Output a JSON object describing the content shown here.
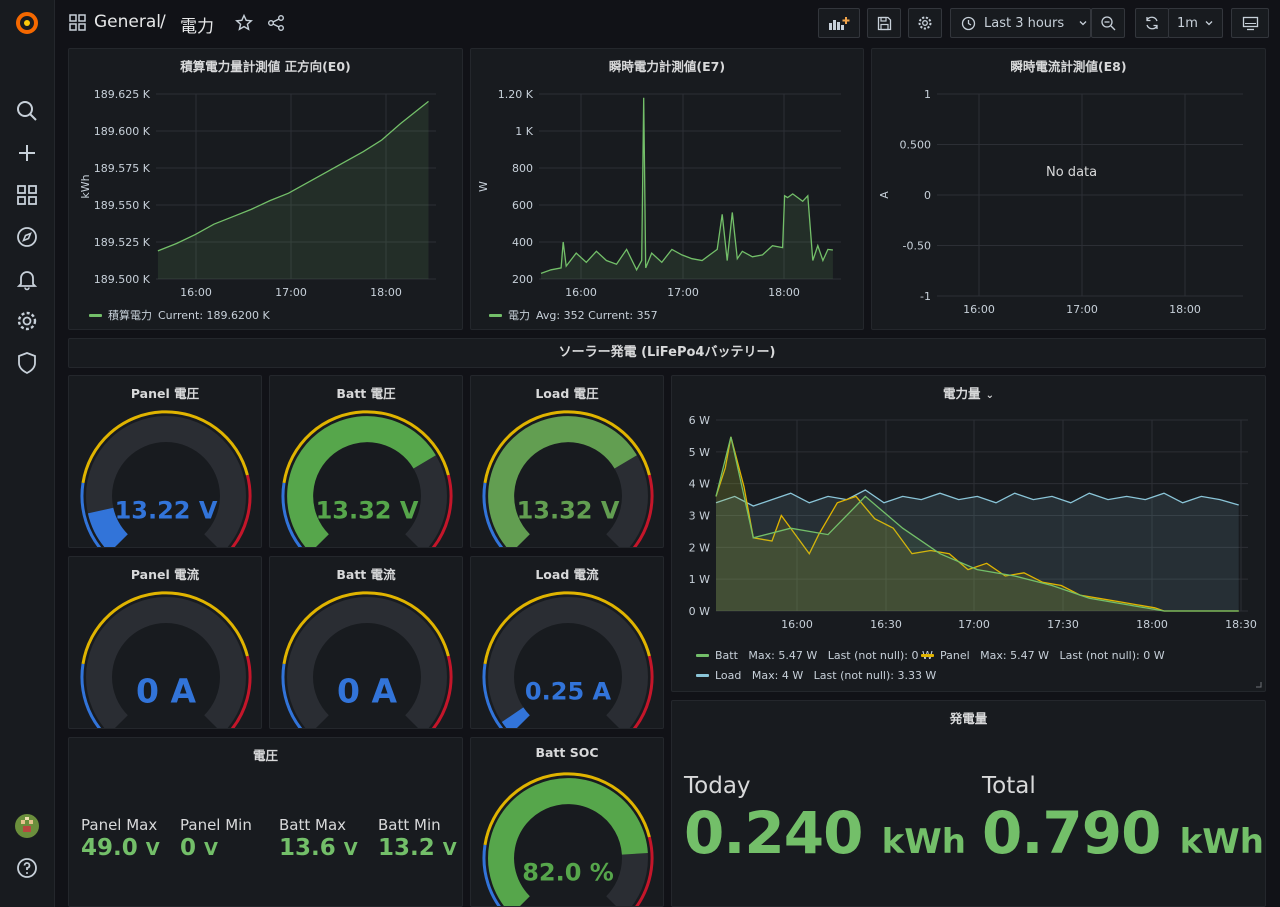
{
  "app": {
    "breadcrumb_folder": "General",
    "breadcrumb_sep": "/",
    "breadcrumb_title": "電力",
    "time_range": "Last 3 hours",
    "refresh_interval": "1m"
  },
  "colors": {
    "bg": "#111217",
    "panel": "#181b1f",
    "green": "#73bf69",
    "yellow": "#e0b400",
    "orange": "#f2cc0c",
    "red": "#c4162a",
    "blue": "#3274d9",
    "cyan": "#8ac5d8",
    "text": "#d8d9da"
  },
  "sidebar": {
    "items": [
      {
        "name": "search-icon"
      },
      {
        "name": "plus-icon"
      },
      {
        "name": "dashboards-icon"
      },
      {
        "name": "explore-icon"
      },
      {
        "name": "alerting-bell-icon"
      },
      {
        "name": "configuration-gear-icon"
      },
      {
        "name": "server-admin-shield-icon"
      }
    ]
  },
  "panels": {
    "energy": {
      "title": "積算電力量計測値 正方向(E0)",
      "legend_name": "積算電力",
      "legend_stats": "Current: 189.6200 K"
    },
    "power": {
      "title": "瞬時電力計測値(E7)",
      "legend_name": "電力",
      "legend_stats": "Avg: 352  Current: 357"
    },
    "current": {
      "title": "瞬時電流計測値(E8)",
      "no_data": "No data"
    },
    "row_title": "ソーラー発電 (LiFePo4バッテリー)",
    "gauges": [
      {
        "title": "Panel 電圧",
        "value": "13.22 V",
        "fraction": 0.12,
        "color": "#3274d9"
      },
      {
        "title": "Batt 電圧",
        "value": "13.32 V",
        "fraction": 0.72,
        "color": "#56a64b"
      },
      {
        "title": "Load 電圧",
        "value": "13.32 V",
        "fraction": 0.72,
        "color": "#629e51"
      },
      {
        "title": "Panel 電流",
        "value": "0 A",
        "fraction": 0.0,
        "color": "#3274d9"
      },
      {
        "title": "Batt 電流",
        "value": "0 A",
        "fraction": 0.0,
        "color": "#3274d9"
      },
      {
        "title": "Load 電流",
        "value": "0.25 A",
        "fraction": 0.04,
        "color": "#3274d9"
      }
    ],
    "power_amount": {
      "title": "電力量",
      "legend_batt": "Batt   Max: 5.47 W   Last (not null): 0 W",
      "legend_panel": "Panel   Max: 5.47 W   Last (not null): 0 W",
      "legend_load": "Load   Max: 4 W   Last (not null): 3.33 W"
    },
    "voltage": {
      "title": "電圧",
      "items": [
        {
          "label": "Panel Max",
          "value": "49.0",
          "unit": "V"
        },
        {
          "label": "Panel Min",
          "value": "0",
          "unit": "V"
        },
        {
          "label": "Batt Max",
          "value": "13.6",
          "unit": "V"
        },
        {
          "label": "Batt Min",
          "value": "13.2",
          "unit": "V"
        }
      ]
    },
    "soc": {
      "title": "Batt SOC",
      "value": "82.0 %",
      "fraction": 0.82
    },
    "generation": {
      "title": "発電量",
      "today_label": "Today",
      "today_value": "0.240",
      "today_unit": "kWh",
      "total_label": "Total",
      "total_value": "0.790",
      "total_unit": "kWh"
    }
  },
  "chart_data": [
    {
      "type": "area",
      "title": "積算電力量計測値 正方向(E0)",
      "ylabel": "kWh",
      "y_ticks": [
        "189.500 K",
        "189.525 K",
        "189.550 K",
        "189.575 K",
        "189.600 K",
        "189.625 K"
      ],
      "x_ticks": [
        "16:00",
        "17:00",
        "18:00"
      ],
      "ylim": [
        189.5,
        189.625
      ],
      "xlim_hours": [
        15.58,
        18.58
      ],
      "series": [
        {
          "name": "積算電力",
          "x": [
            15.6,
            15.8,
            16.0,
            16.2,
            16.4,
            16.6,
            16.8,
            17.0,
            17.2,
            17.4,
            17.6,
            17.8,
            18.0,
            18.2,
            18.4,
            18.5
          ],
          "y": [
            189.519,
            189.524,
            189.53,
            189.537,
            189.542,
            189.547,
            189.553,
            189.558,
            189.565,
            189.572,
            189.579,
            189.586,
            189.594,
            189.605,
            189.615,
            189.62
          ]
        }
      ]
    },
    {
      "type": "line",
      "title": "瞬時電力計測値(E7)",
      "ylabel": "W",
      "y_ticks": [
        "200",
        "400",
        "600",
        "800",
        "1 K",
        "1.20 K"
      ],
      "x_ticks": [
        "16:00",
        "17:00",
        "18:00"
      ],
      "ylim": [
        200,
        1200
      ],
      "xlim_hours": [
        15.58,
        18.58
      ],
      "series": [
        {
          "name": "電力",
          "x": [
            15.6,
            15.7,
            15.8,
            15.82,
            15.85,
            15.95,
            16.05,
            16.15,
            16.25,
            16.35,
            16.45,
            16.55,
            16.6,
            16.62,
            16.64,
            16.7,
            16.8,
            16.9,
            17.0,
            17.1,
            17.2,
            17.3,
            17.35,
            17.4,
            17.45,
            17.5,
            17.55,
            17.6,
            17.7,
            17.8,
            17.9,
            18.0,
            18.02,
            18.05,
            18.1,
            18.2,
            18.25,
            18.3,
            18.35,
            18.4,
            18.45,
            18.5
          ],
          "y": [
            230,
            250,
            260,
            400,
            270,
            340,
            290,
            350,
            300,
            280,
            360,
            250,
            300,
            1180,
            260,
            340,
            290,
            360,
            330,
            310,
            300,
            340,
            360,
            550,
            300,
            560,
            310,
            350,
            320,
            330,
            380,
            370,
            650,
            640,
            660,
            620,
            650,
            300,
            380,
            300,
            360,
            357
          ]
        }
      ]
    },
    {
      "type": "line",
      "title": "瞬時電流計測値(E8)",
      "ylabel": "A",
      "y_ticks": [
        "-1",
        "-0.50",
        "0",
        "0.500",
        "1"
      ],
      "x_ticks": [
        "16:00",
        "17:00",
        "18:00"
      ],
      "ylim": [
        -1,
        1
      ],
      "series": []
    },
    {
      "type": "area",
      "title": "電力量",
      "y_ticks": [
        "0 W",
        "1 W",
        "2 W",
        "3 W",
        "4 W",
        "5 W",
        "6 W"
      ],
      "x_ticks": [
        "16:00",
        "16:30",
        "17:00",
        "17:30",
        "18:00",
        "18:30"
      ],
      "ylim": [
        0,
        6
      ],
      "xlim_hours": [
        15.7,
        18.55
      ],
      "series": [
        {
          "name": "Load",
          "x": [
            15.7,
            15.8,
            15.9,
            16.0,
            16.1,
            16.2,
            16.3,
            16.4,
            16.5,
            16.6,
            16.7,
            16.8,
            16.9,
            17.0,
            17.1,
            17.2,
            17.3,
            17.4,
            17.5,
            17.6,
            17.7,
            17.8,
            17.9,
            18.0,
            18.1,
            18.2,
            18.3,
            18.4,
            18.5
          ],
          "y": [
            3.4,
            3.6,
            3.3,
            3.5,
            3.7,
            3.4,
            3.6,
            3.5,
            3.8,
            3.4,
            3.6,
            3.5,
            3.7,
            3.5,
            3.6,
            3.4,
            3.7,
            3.5,
            3.6,
            3.4,
            3.7,
            3.5,
            3.6,
            3.5,
            3.7,
            3.4,
            3.6,
            3.5,
            3.33
          ]
        },
        {
          "name": "Panel",
          "x": [
            15.7,
            15.75,
            15.78,
            15.85,
            15.9,
            16.0,
            16.05,
            16.1,
            16.2,
            16.25,
            16.35,
            16.45,
            16.55,
            16.65,
            16.75,
            16.85,
            16.95,
            17.05,
            17.15,
            17.25,
            17.35,
            17.45,
            17.55,
            17.65,
            17.75,
            17.85,
            17.95,
            18.05,
            18.1,
            18.5
          ],
          "y": [
            3.6,
            4.5,
            5.47,
            3.9,
            2.3,
            2.2,
            3.0,
            2.6,
            1.8,
            2.4,
            3.4,
            3.6,
            2.9,
            2.6,
            1.8,
            1.9,
            1.8,
            1.3,
            1.5,
            1.1,
            1.2,
            0.9,
            0.8,
            0.5,
            0.4,
            0.3,
            0.2,
            0.1,
            0,
            0
          ]
        },
        {
          "name": "Batt",
          "x": [
            15.7,
            15.78,
            15.9,
            16.1,
            16.3,
            16.5,
            16.7,
            16.9,
            17.1,
            17.3,
            17.5,
            17.7,
            17.9,
            18.1,
            18.5
          ],
          "y": [
            3.6,
            5.47,
            2.3,
            2.6,
            2.4,
            3.6,
            2.6,
            1.8,
            1.3,
            1.1,
            0.8,
            0.4,
            0.2,
            0,
            0
          ]
        }
      ]
    }
  ]
}
